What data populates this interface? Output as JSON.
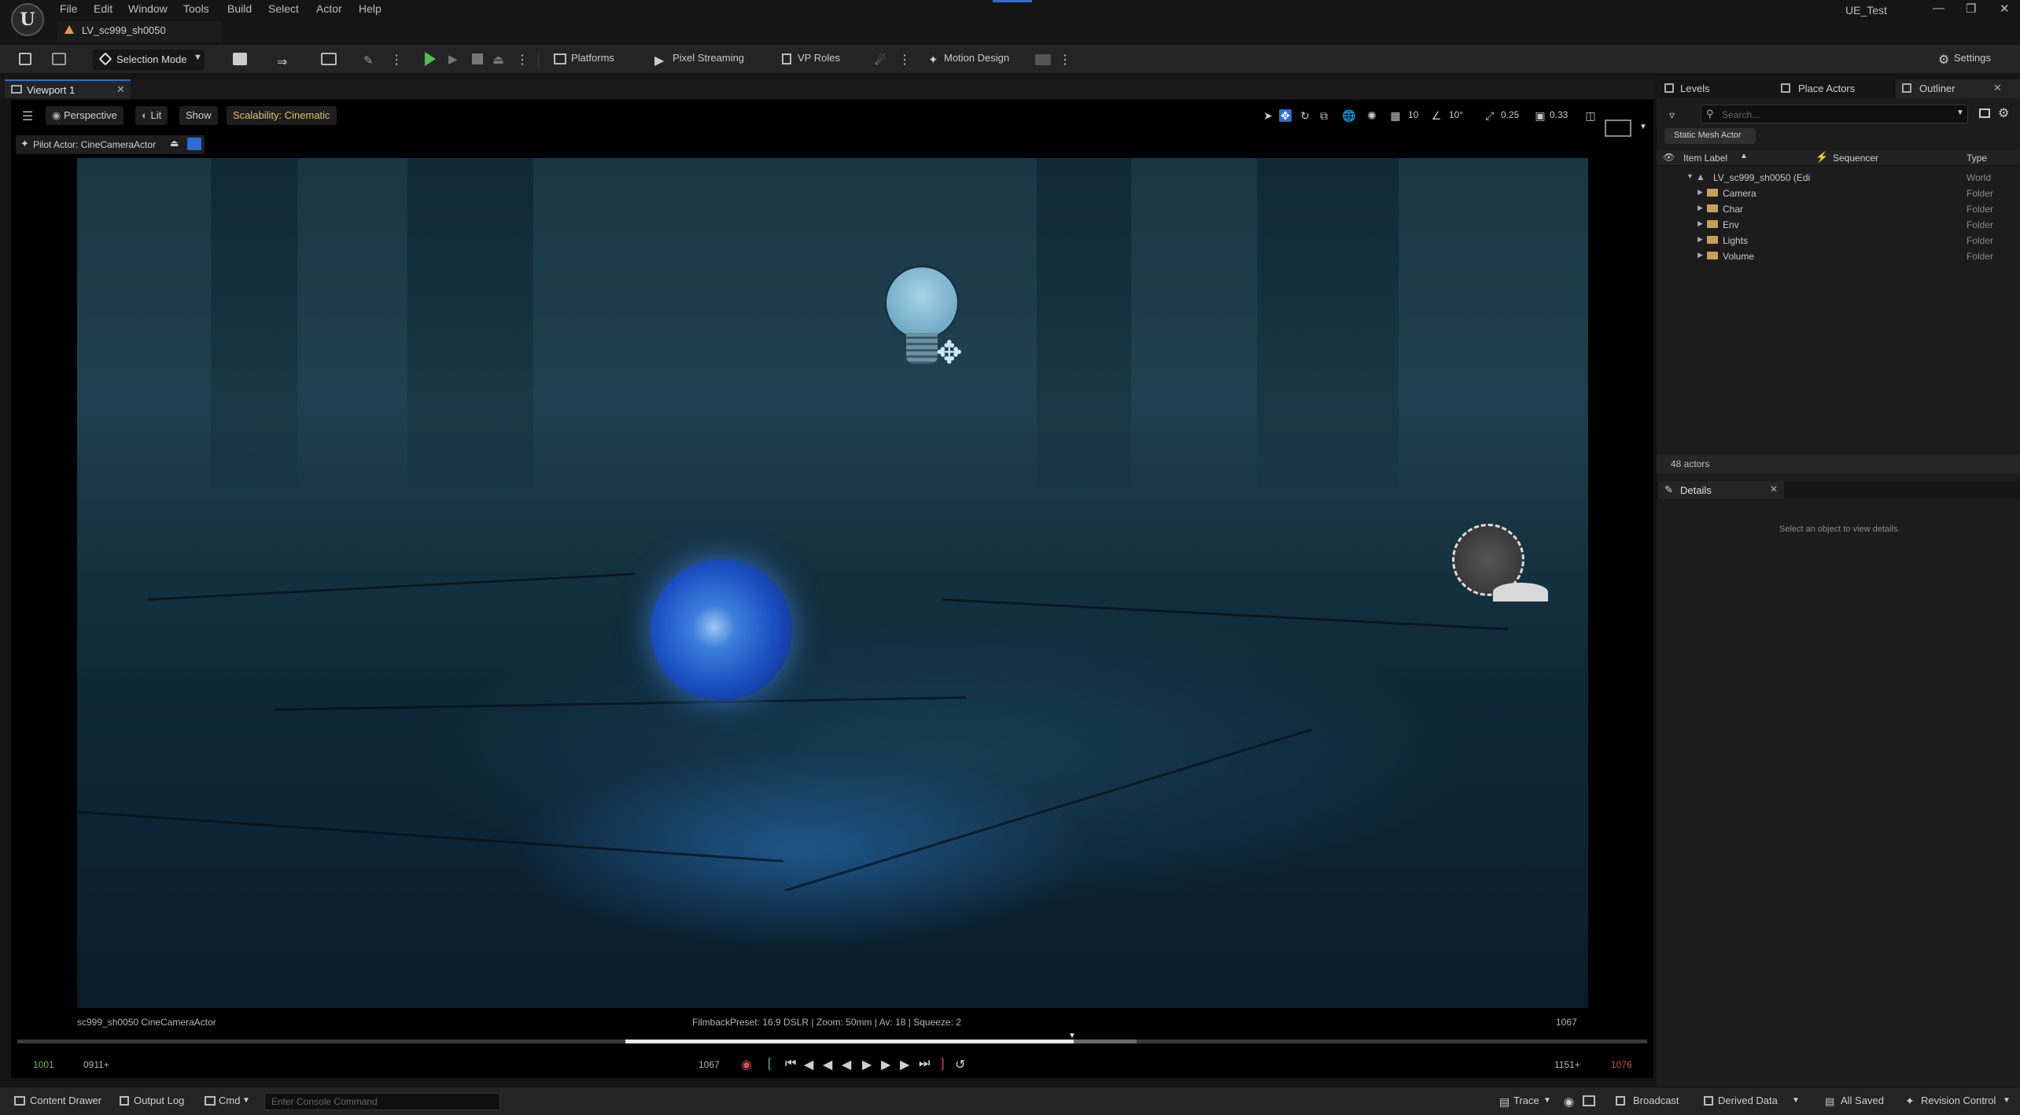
{
  "app": {
    "title": "UE_Test",
    "logo": "U"
  },
  "menu": [
    "File",
    "Edit",
    "Window",
    "Tools",
    "Build",
    "Select",
    "Actor",
    "Help"
  ],
  "level_tab": {
    "label": "LV_sc999_sh0050"
  },
  "toolbar": {
    "selection_mode": "Selection Mode",
    "platforms": "Platforms",
    "pixel_streaming": "Pixel Streaming",
    "vp_roles": "VP Roles",
    "motion_design": "Motion Design",
    "settings": "Settings"
  },
  "viewport": {
    "tab_label": "Viewport 1",
    "perspective": "Perspective",
    "lit": "Lit",
    "show": "Show",
    "scalability": "Scalability: Cinematic",
    "pilot_actor": "Pilot Actor: CineCameraActor",
    "grid_snap": "10",
    "rot_snap": "10°",
    "scale_snap": "0.25",
    "cam_speed": "0.33",
    "camera_name": "sc999_sh0050 CineCameraActor",
    "filmback": "FilmbackPreset: 16:9 DSLR | Zoom: 50mm | Av: 18 | Squeeze: 2",
    "frame_right": "1067"
  },
  "timeline": {
    "start": "1001",
    "playback_start": "0911+",
    "current": "1067",
    "playback_end": "1151+",
    "end": "1076"
  },
  "panel_tabs": {
    "levels": "Levels",
    "place_actors": "Place Actors",
    "outliner": "Outliner"
  },
  "outliner": {
    "search_placeholder": "Search...",
    "filter_chip": "Static Mesh Actor",
    "col_label": "Item Label",
    "col_sequencer": "Sequencer",
    "col_type": "Type",
    "root": {
      "label": "LV_sc999_sh0050 (Edi",
      "type": "World"
    },
    "items": [
      {
        "label": "Camera",
        "type": "Folder"
      },
      {
        "label": "Char",
        "type": "Folder"
      },
      {
        "label": "Env",
        "type": "Folder"
      },
      {
        "label": "Lights",
        "type": "Folder"
      },
      {
        "label": "Volume",
        "type": "Folder"
      }
    ],
    "actor_count": "48 actors"
  },
  "details": {
    "tab": "Details",
    "empty_message": "Select an object to view details."
  },
  "statusbar": {
    "content_drawer": "Content Drawer",
    "output_log": "Output Log",
    "cmd": "Cmd",
    "console_placeholder": "Enter Console Command",
    "trace": "Trace",
    "broadcast": "Broadcast",
    "derived_data": "Derived Data",
    "all_saved": "All Saved",
    "revision_control": "Revision Control"
  },
  "colors": {
    "accent_blue": "#2d6bd6",
    "scalability_yellow": "#e3c25a",
    "frame_red": "#d05050",
    "frame_green": "#5fbf5f",
    "folder": "#c8a055"
  }
}
